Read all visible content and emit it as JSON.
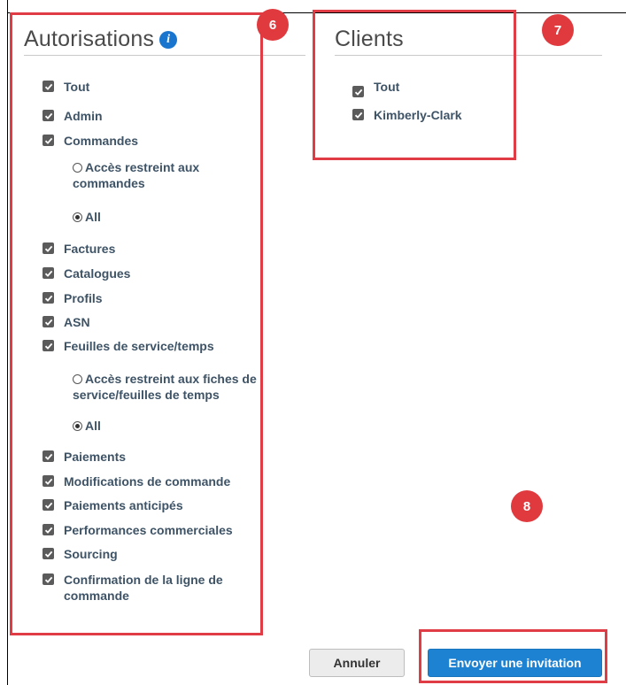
{
  "authorizations": {
    "title": "Autorisations",
    "info_icon": "info-icon",
    "items": [
      {
        "label": "Tout",
        "checked": true
      },
      {
        "label": "Admin",
        "checked": true
      },
      {
        "label": "Commandes",
        "checked": true
      },
      {
        "label": "Factures",
        "checked": true
      },
      {
        "label": "Catalogues",
        "checked": true
      },
      {
        "label": "Profils",
        "checked": true
      },
      {
        "label": "ASN",
        "checked": true
      },
      {
        "label": "Feuilles de service/temps",
        "checked": true
      },
      {
        "label": "Paiements",
        "checked": true
      },
      {
        "label": "Modifications de commande",
        "checked": true
      },
      {
        "label": "Paiements anticipés",
        "checked": true
      },
      {
        "label": "Performances commerciales",
        "checked": true
      },
      {
        "label": "Sourcing",
        "checked": true
      },
      {
        "label": "Confirmation de la ligne de commande",
        "checked": true
      }
    ],
    "orders_options": [
      {
        "label": "Accès restreint aux commandes",
        "selected": false
      },
      {
        "label": "All",
        "selected": true
      }
    ],
    "service_options": [
      {
        "label": "Accès restreint aux fiches de service/feuilles de temps",
        "selected": false
      },
      {
        "label": "All",
        "selected": true
      }
    ]
  },
  "clients": {
    "title": "Clients",
    "items": [
      {
        "label": "Tout",
        "checked": true
      },
      {
        "label": "Kimberly-Clark",
        "checked": true
      }
    ]
  },
  "badges": [
    "6",
    "7",
    "8"
  ],
  "buttons": {
    "cancel": "Annuler",
    "send": "Envoyer une invitation"
  },
  "colors": {
    "highlight": "#e03c46",
    "badge": "#e0393e",
    "primary_button": "#1e82d2",
    "text": "#3e5366"
  }
}
